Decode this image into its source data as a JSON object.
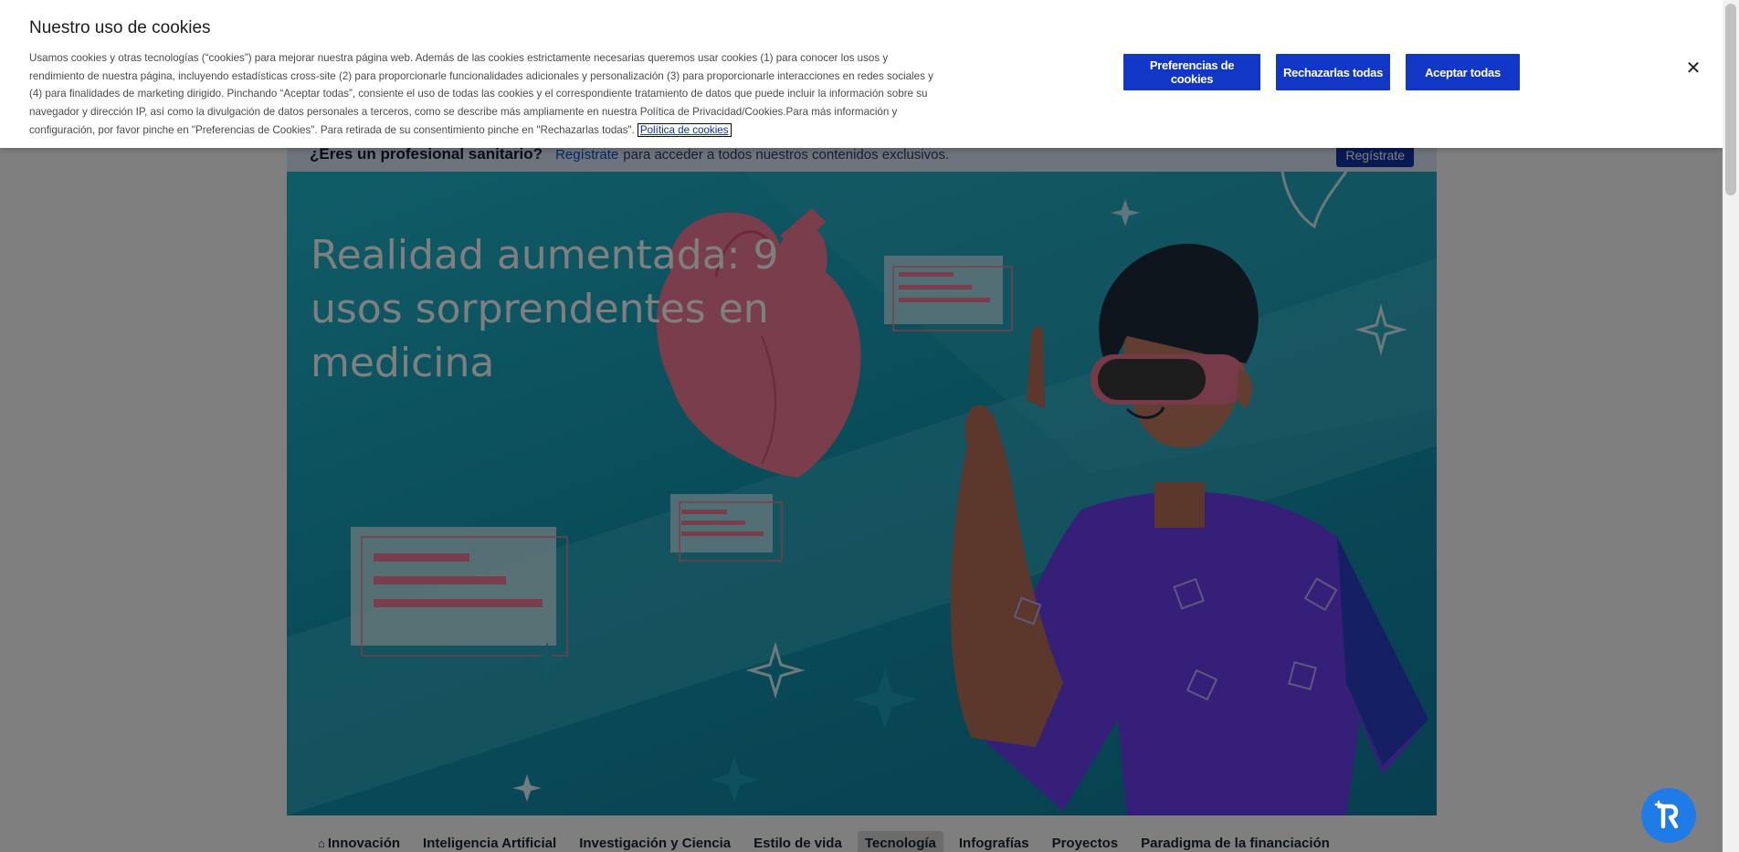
{
  "cookie_banner": {
    "title": "Nuestro uso de cookies",
    "text": "Usamos cookies y otras tecnologías (“cookies”) para mejorar nuestra página web. Además de las cookies estrictamente necesarias queremos usar cookies (1) para conocer los usos y rendimiento de nuestra página, incluyendo estadísticas cross-site (2) para proporcionarle funcionalidades adicionales y personalización (3) para proporcionarle interacciones en redes sociales y (4) para finalidades de marketing dirigido. Pinchando “Aceptar todas”, consiente el uso de todas las cookies y el correspondiente tratamiento de datos que puede incluir la información sobre su navegador y dirección IP, así como la divulgación de datos personales a terceros, como se describe más ampliamente en nuestra Política de Privacidad/Cookies.Para más información y configuración, por favor pinche en \"Preferencias de Cookies\". Para retirada de su consentimiento pinche en \"Rechazarlas todas\".",
    "policy_link": "Política de cookies",
    "preferences_label": "Preferencias de cookies",
    "reject_label": "Rechazarlas todas",
    "accept_label": "Aceptar todas",
    "close_icon": "close-icon"
  },
  "pro_bar": {
    "question": "¿Eres un profesional sanitario?",
    "link": "Regístrate",
    "rest": "para acceder a todos nuestros contenidos exclusivos.",
    "button": "Regístrate"
  },
  "hero": {
    "title": "Realidad aumentada: 9 usos sorprendentes en medicina"
  },
  "nav": {
    "home_icon": "home-icon",
    "items": [
      "Innovación",
      "Inteligencia Artificial",
      "Investigación y Ciencia",
      "Estilo de vida",
      "Tecnología",
      "Infografías",
      "Proyectos",
      "Paradigma de la financiación"
    ],
    "active_index": 4
  },
  "colors": {
    "accent": "#1237c7",
    "hero_bg": "#159ab4",
    "fab": "#1f7be6"
  }
}
